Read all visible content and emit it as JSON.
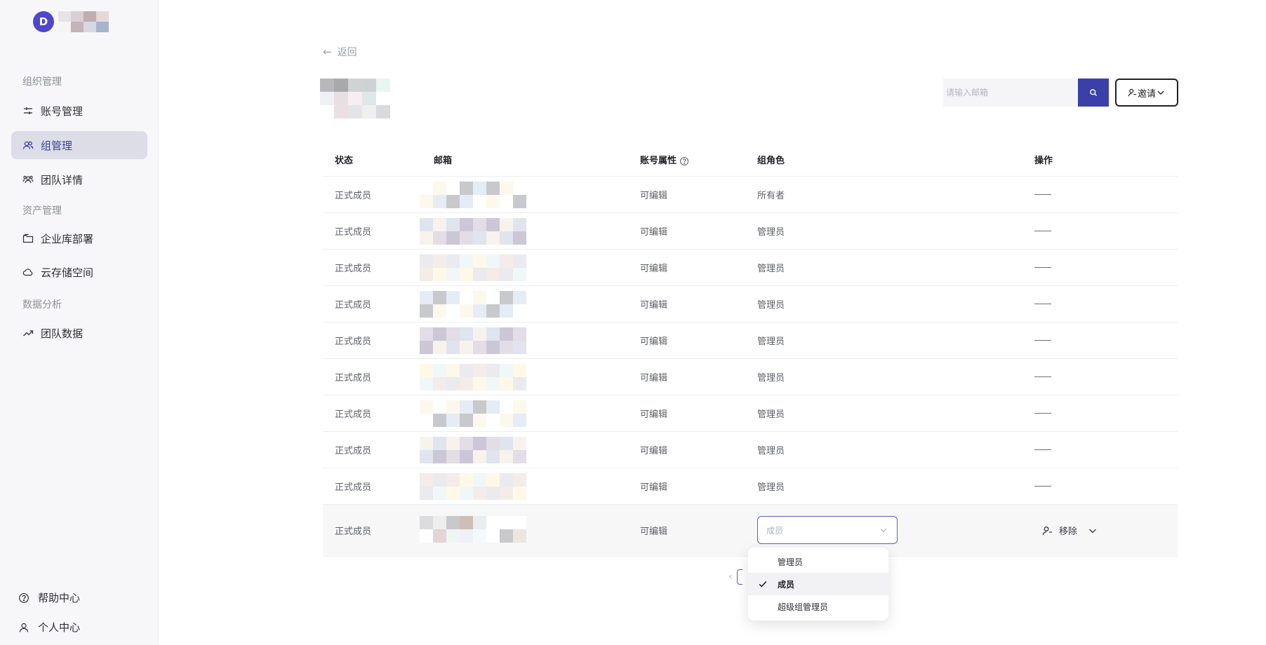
{
  "sidebar": {
    "avatar_letter": "D",
    "groups": [
      {
        "label": "组织管理"
      },
      {
        "label": "资产管理"
      },
      {
        "label": "数据分析"
      }
    ],
    "items": [
      {
        "label": "账号管理",
        "icon": "sliders-icon"
      },
      {
        "label": "组管理",
        "icon": "users-icon",
        "active": true
      },
      {
        "label": "团队详情",
        "icon": "team-icon"
      },
      {
        "label": "企业库部署",
        "icon": "folder-icon"
      },
      {
        "label": "云存储空间",
        "icon": "cloud-icon"
      },
      {
        "label": "团队数据",
        "icon": "trend-icon"
      }
    ],
    "bottom": [
      {
        "label": "帮助中心",
        "icon": "help-icon"
      },
      {
        "label": "个人中心",
        "icon": "user-icon"
      }
    ]
  },
  "header": {
    "back_label": "返回",
    "search_placeholder": "请输入邮箱",
    "invite_label": "邀请"
  },
  "table": {
    "columns": [
      "状态",
      "邮箱",
      "账号属性",
      "组角色",
      "操作"
    ],
    "rows": [
      {
        "status": "正式成员",
        "attr": "可编辑",
        "role": "所有者"
      },
      {
        "status": "正式成员",
        "attr": "可编辑",
        "role": "管理员"
      },
      {
        "status": "正式成员",
        "attr": "可编辑",
        "role": "管理员"
      },
      {
        "status": "正式成员",
        "attr": "可编辑",
        "role": "管理员"
      },
      {
        "status": "正式成员",
        "attr": "可编辑",
        "role": "管理员"
      },
      {
        "status": "正式成员",
        "attr": "可编辑",
        "role": "管理员"
      },
      {
        "status": "正式成员",
        "attr": "可编辑",
        "role": "管理员"
      },
      {
        "status": "正式成员",
        "attr": "可编辑",
        "role": "管理员"
      },
      {
        "status": "正式成员",
        "attr": "可编辑",
        "role": "管理员"
      }
    ],
    "selected_row": {
      "status": "正式成员",
      "attr": "可编辑",
      "role_placeholder": "成员",
      "remove_label": "移除"
    }
  },
  "dropdown": {
    "options": [
      "管理员",
      "成员",
      "超级组管理员"
    ],
    "selected": "成员"
  },
  "colors": {
    "accent": "#3b3fa8",
    "avatar": "#4f46c9",
    "active_bg": "#dcdde6"
  }
}
